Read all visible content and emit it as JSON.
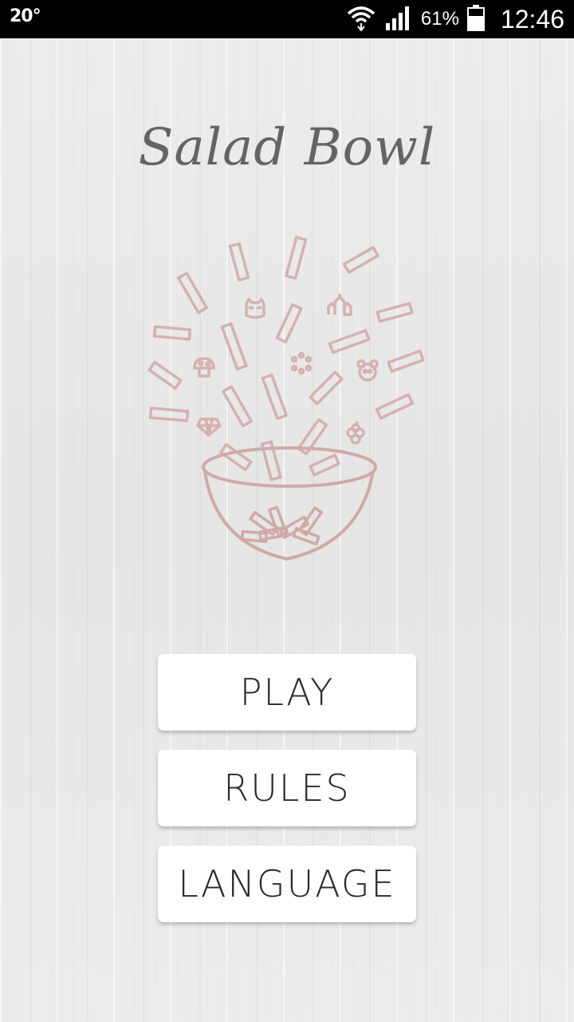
{
  "status_bar": {
    "temperature": "20°",
    "battery_percent": "61%",
    "time": "12:46",
    "icons": [
      "wifi-icon",
      "signal-icon",
      "battery-icon"
    ]
  },
  "app": {
    "title": "Salad Bowl"
  },
  "illustration": {
    "name": "salad-bowl-illustration",
    "color": "#d4b2b0",
    "bowl_color": "#d0aaa8"
  },
  "menu": {
    "play_label": "PLAY",
    "rules_label": "RULES",
    "language_label": "LANGUAGE"
  },
  "colors": {
    "background": "#e9e9e9",
    "title": "#646464",
    "button_bg": "#ffffff",
    "button_text": "#2a2a2a"
  }
}
